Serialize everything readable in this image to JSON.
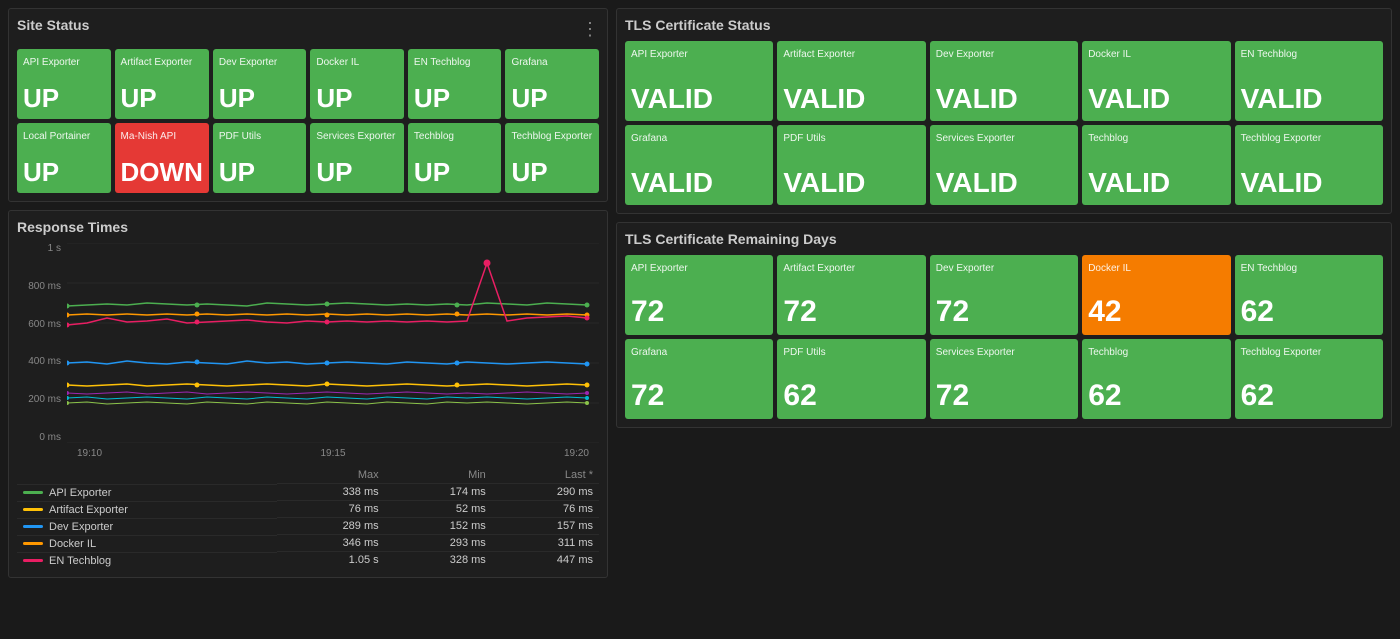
{
  "siteStatus": {
    "title": "Site Status",
    "tiles": [
      {
        "name": "API Exporter",
        "status": "UP",
        "down": false
      },
      {
        "name": "Artifact Exporter",
        "status": "UP",
        "down": false
      },
      {
        "name": "Dev Exporter",
        "status": "UP",
        "down": false
      },
      {
        "name": "Docker IL",
        "status": "UP",
        "down": false
      },
      {
        "name": "EN Techblog",
        "status": "UP",
        "down": false
      },
      {
        "name": "Grafana",
        "status": "UP",
        "down": false
      },
      {
        "name": "Local Portainer",
        "status": "UP",
        "down": false
      },
      {
        "name": "Ma-Nish API",
        "status": "DOWN",
        "down": true
      },
      {
        "name": "PDF Utils",
        "status": "UP",
        "down": false
      },
      {
        "name": "Services Exporter",
        "status": "UP",
        "down": false
      },
      {
        "name": "Techblog",
        "status": "UP",
        "down": false
      },
      {
        "name": "Techblog Exporter",
        "status": "UP",
        "down": false
      }
    ]
  },
  "responseTimes": {
    "title": "Response Times",
    "yLabels": [
      "1 s",
      "800 ms",
      "600 ms",
      "400 ms",
      "200 ms",
      "0 ms"
    ],
    "xLabels": [
      "19:10",
      "19:15",
      "19:20"
    ],
    "legend": [
      {
        "name": "API Exporter",
        "color": "#4caf50",
        "max": "338 ms",
        "min": "174 ms",
        "last": "290 ms"
      },
      {
        "name": "Artifact Exporter",
        "color": "#ffc107",
        "max": "76 ms",
        "min": "52 ms",
        "last": "76 ms"
      },
      {
        "name": "Dev Exporter",
        "color": "#2196f3",
        "max": "289 ms",
        "min": "152 ms",
        "last": "157 ms"
      },
      {
        "name": "Docker IL",
        "color": "#ff9800",
        "max": "346 ms",
        "min": "293 ms",
        "last": "311 ms"
      },
      {
        "name": "EN Techblog",
        "color": "#e91e63",
        "max": "1.05 s",
        "min": "328 ms",
        "last": "447 ms"
      }
    ],
    "legendHeaders": [
      "Max",
      "Min",
      "Last *"
    ]
  },
  "tlsCertStatus": {
    "title": "TLS Certificate Status",
    "tiles": [
      {
        "name": "API Exporter",
        "value": "VALID"
      },
      {
        "name": "Artifact Exporter",
        "value": "VALID"
      },
      {
        "name": "Dev Exporter",
        "value": "VALID"
      },
      {
        "name": "Docker IL",
        "value": "VALID"
      },
      {
        "name": "EN Techblog",
        "value": "VALID"
      },
      {
        "name": "Grafana",
        "value": "VALID"
      },
      {
        "name": "PDF Utils",
        "value": "VALID"
      },
      {
        "name": "Services Exporter",
        "value": "VALID"
      },
      {
        "name": "Techblog",
        "value": "VALID"
      },
      {
        "name": "Techblog Exporter",
        "value": "VALID"
      }
    ]
  },
  "tlsCertDays": {
    "title": "TLS Certificate Remaining Days",
    "tiles": [
      {
        "name": "API Exporter",
        "value": "72",
        "orange": false
      },
      {
        "name": "Artifact Exporter",
        "value": "72",
        "orange": false
      },
      {
        "name": "Dev Exporter",
        "value": "72",
        "orange": false
      },
      {
        "name": "Docker IL",
        "value": "42",
        "orange": true
      },
      {
        "name": "EN Techblog",
        "value": "62",
        "orange": false
      },
      {
        "name": "Grafana",
        "value": "72",
        "orange": false
      },
      {
        "name": "PDF Utils",
        "value": "62",
        "orange": false
      },
      {
        "name": "Services Exporter",
        "value": "72",
        "orange": false
      },
      {
        "name": "Techblog",
        "value": "62",
        "orange": false
      },
      {
        "name": "Techblog Exporter",
        "value": "62",
        "orange": false
      }
    ]
  }
}
